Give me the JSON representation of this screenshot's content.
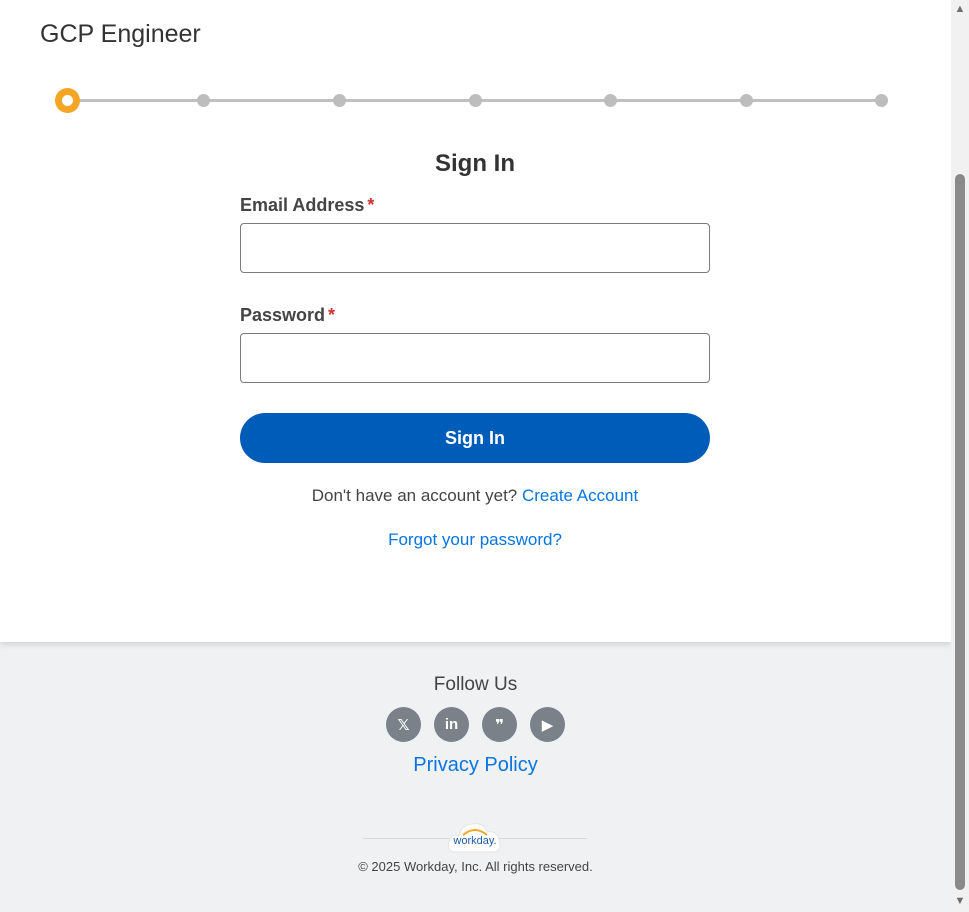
{
  "header": {
    "job_title": "GCP Engineer"
  },
  "stepper": {
    "total_steps": 7,
    "current_step": 1,
    "active_color": "#f5a524"
  },
  "form": {
    "title": "Sign In",
    "email_label": "Email Address",
    "email_value": "",
    "password_label": "Password",
    "password_value": "",
    "required_marker": "*",
    "submit_label": "Sign In",
    "no_account_text": "Don't have an account yet?",
    "create_account_label": "Create Account",
    "forgot_password_label": "Forgot your password?"
  },
  "footer": {
    "follow_label": "Follow Us",
    "social": [
      {
        "icon": "x-twitter-icon",
        "glyph": "𝕏"
      },
      {
        "icon": "linkedin-icon",
        "glyph": "in"
      },
      {
        "icon": "blog-icon",
        "glyph": "❞"
      },
      {
        "icon": "youtube-icon",
        "glyph": "▶"
      }
    ],
    "privacy_label": "Privacy Policy",
    "logo_text": "workday.",
    "copyright": "© 2025 Workday, Inc. All rights reserved."
  },
  "colors": {
    "primary_button": "#005cb9",
    "link": "#0875e1",
    "required": "#d0312d"
  }
}
